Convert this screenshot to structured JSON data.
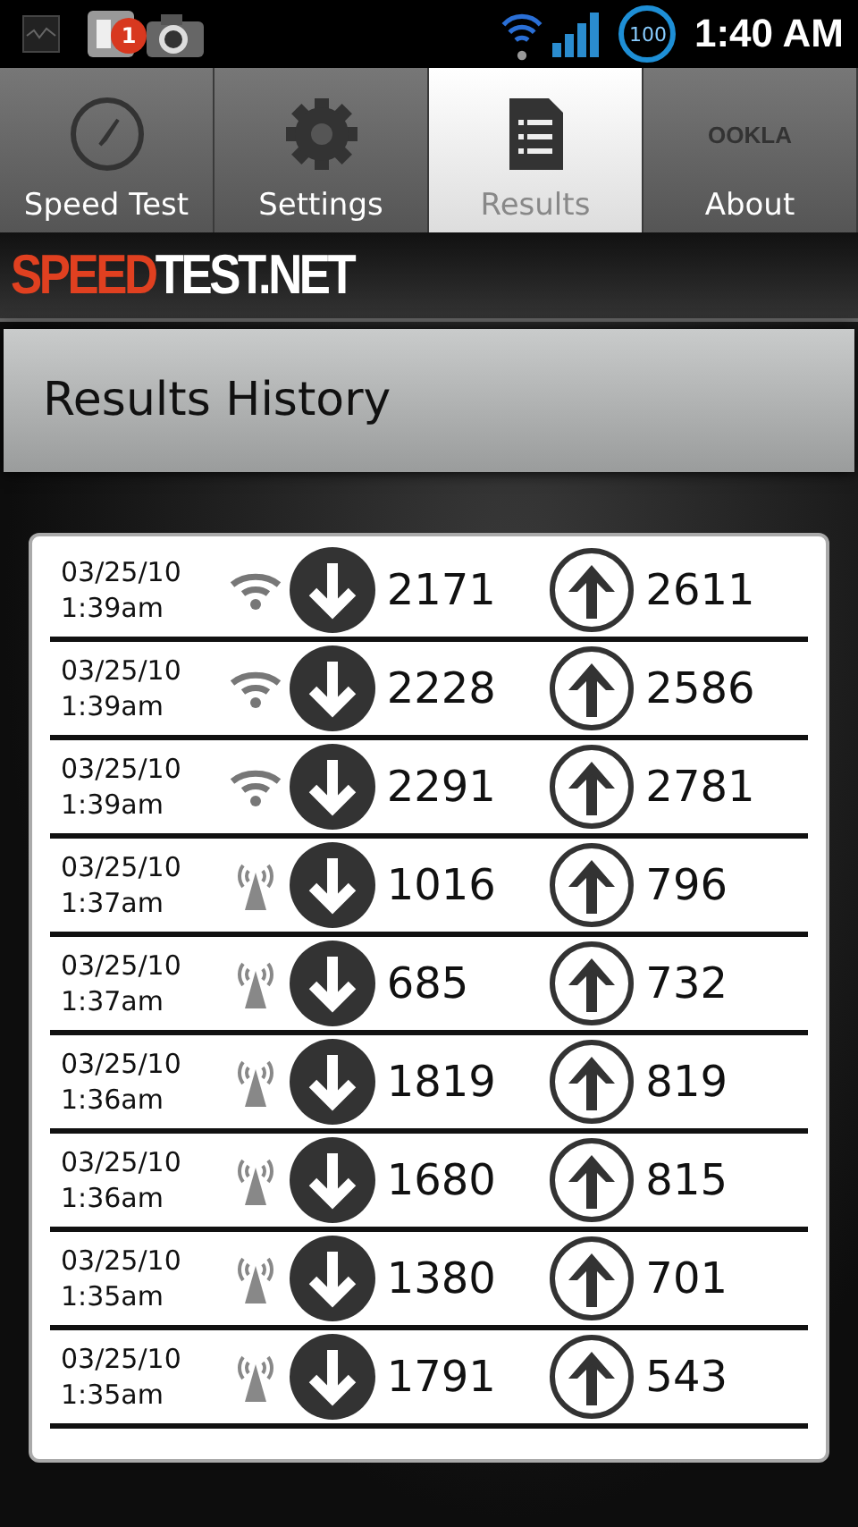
{
  "status_bar": {
    "notification_count": "1",
    "battery": "100",
    "time": "1:40 AM"
  },
  "tabs": [
    {
      "label": "Speed Test",
      "kind": "gauge",
      "selected": false
    },
    {
      "label": "Settings",
      "kind": "gear",
      "selected": false
    },
    {
      "label": "Results",
      "kind": "document",
      "selected": true
    },
    {
      "label": "About",
      "kind": "logo",
      "logo_text": "OOKLA",
      "selected": false
    }
  ],
  "brand": {
    "part_1": "SPEED",
    "part_2": "TEST.NET"
  },
  "title": "Results History",
  "results": [
    {
      "date": "03/25/10",
      "time": "1:39am",
      "kind": "wifi",
      "download": "2171",
      "upload": "2611"
    },
    {
      "date": "03/25/10",
      "time": "1:39am",
      "kind": "wifi",
      "download": "2228",
      "upload": "2586"
    },
    {
      "date": "03/25/10",
      "time": "1:39am",
      "kind": "wifi",
      "download": "2291",
      "upload": "2781"
    },
    {
      "date": "03/25/10",
      "time": "1:37am",
      "kind": "cell",
      "download": "1016",
      "upload": "796"
    },
    {
      "date": "03/25/10",
      "time": "1:37am",
      "kind": "cell",
      "download": "685",
      "upload": "732"
    },
    {
      "date": "03/25/10",
      "time": "1:36am",
      "kind": "cell",
      "download": "1819",
      "upload": "819"
    },
    {
      "date": "03/25/10",
      "time": "1:36am",
      "kind": "cell",
      "download": "1680",
      "upload": "815"
    },
    {
      "date": "03/25/10",
      "time": "1:35am",
      "kind": "cell",
      "download": "1380",
      "upload": "701"
    },
    {
      "date": "03/25/10",
      "time": "1:35am",
      "kind": "cell",
      "download": "1791",
      "upload": "543"
    }
  ]
}
